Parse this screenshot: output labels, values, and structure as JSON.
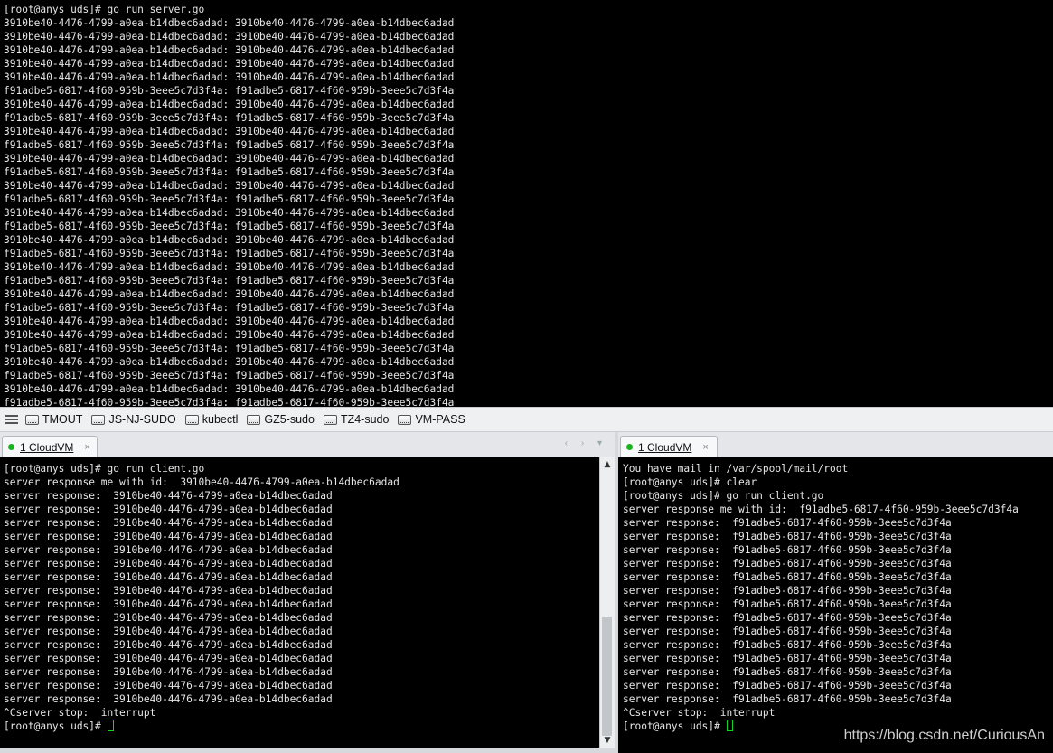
{
  "top_terminal": {
    "lines": [
      "[root@anys uds]# go run server.go",
      "3910be40-4476-4799-a0ea-b14dbec6adad: 3910be40-4476-4799-a0ea-b14dbec6adad",
      "3910be40-4476-4799-a0ea-b14dbec6adad: 3910be40-4476-4799-a0ea-b14dbec6adad",
      "3910be40-4476-4799-a0ea-b14dbec6adad: 3910be40-4476-4799-a0ea-b14dbec6adad",
      "3910be40-4476-4799-a0ea-b14dbec6adad: 3910be40-4476-4799-a0ea-b14dbec6adad",
      "3910be40-4476-4799-a0ea-b14dbec6adad: 3910be40-4476-4799-a0ea-b14dbec6adad",
      "f91adbe5-6817-4f60-959b-3eee5c7d3f4a: f91adbe5-6817-4f60-959b-3eee5c7d3f4a",
      "3910be40-4476-4799-a0ea-b14dbec6adad: 3910be40-4476-4799-a0ea-b14dbec6adad",
      "f91adbe5-6817-4f60-959b-3eee5c7d3f4a: f91adbe5-6817-4f60-959b-3eee5c7d3f4a",
      "3910be40-4476-4799-a0ea-b14dbec6adad: 3910be40-4476-4799-a0ea-b14dbec6adad",
      "f91adbe5-6817-4f60-959b-3eee5c7d3f4a: f91adbe5-6817-4f60-959b-3eee5c7d3f4a",
      "3910be40-4476-4799-a0ea-b14dbec6adad: 3910be40-4476-4799-a0ea-b14dbec6adad",
      "f91adbe5-6817-4f60-959b-3eee5c7d3f4a: f91adbe5-6817-4f60-959b-3eee5c7d3f4a",
      "3910be40-4476-4799-a0ea-b14dbec6adad: 3910be40-4476-4799-a0ea-b14dbec6adad",
      "f91adbe5-6817-4f60-959b-3eee5c7d3f4a: f91adbe5-6817-4f60-959b-3eee5c7d3f4a",
      "3910be40-4476-4799-a0ea-b14dbec6adad: 3910be40-4476-4799-a0ea-b14dbec6adad",
      "f91adbe5-6817-4f60-959b-3eee5c7d3f4a: f91adbe5-6817-4f60-959b-3eee5c7d3f4a",
      "3910be40-4476-4799-a0ea-b14dbec6adad: 3910be40-4476-4799-a0ea-b14dbec6adad",
      "f91adbe5-6817-4f60-959b-3eee5c7d3f4a: f91adbe5-6817-4f60-959b-3eee5c7d3f4a",
      "3910be40-4476-4799-a0ea-b14dbec6adad: 3910be40-4476-4799-a0ea-b14dbec6adad",
      "f91adbe5-6817-4f60-959b-3eee5c7d3f4a: f91adbe5-6817-4f60-959b-3eee5c7d3f4a",
      "3910be40-4476-4799-a0ea-b14dbec6adad: 3910be40-4476-4799-a0ea-b14dbec6adad",
      "f91adbe5-6817-4f60-959b-3eee5c7d3f4a: f91adbe5-6817-4f60-959b-3eee5c7d3f4a",
      "3910be40-4476-4799-a0ea-b14dbec6adad: 3910be40-4476-4799-a0ea-b14dbec6adad",
      "3910be40-4476-4799-a0ea-b14dbec6adad: 3910be40-4476-4799-a0ea-b14dbec6adad",
      "f91adbe5-6817-4f60-959b-3eee5c7d3f4a: f91adbe5-6817-4f60-959b-3eee5c7d3f4a",
      "3910be40-4476-4799-a0ea-b14dbec6adad: 3910be40-4476-4799-a0ea-b14dbec6adad",
      "f91adbe5-6817-4f60-959b-3eee5c7d3f4a: f91adbe5-6817-4f60-959b-3eee5c7d3f4a",
      "3910be40-4476-4799-a0ea-b14dbec6adad: 3910be40-4476-4799-a0ea-b14dbec6adad",
      "f91adbe5-6817-4f60-959b-3eee5c7d3f4a: f91adbe5-6817-4f60-959b-3eee5c7d3f4a"
    ]
  },
  "toolbar": {
    "menu_icon": "hamburger-menu-icon",
    "bookmarks": [
      "TMOUT",
      "JS-NJ-SUDO",
      "kubectl",
      "GZ5-sudo",
      "TZ4-sudo",
      "VM-PASS"
    ]
  },
  "left_tab": {
    "label": "1 CloudVM",
    "close": "×"
  },
  "right_tab": {
    "label": "1 CloudVM",
    "close": "×"
  },
  "nav_arrows": "‹ › ▾",
  "left_terminal": {
    "lines": [
      "[root@anys uds]# go run client.go",
      "server response me with id:  3910be40-4476-4799-a0ea-b14dbec6adad",
      "server response:  3910be40-4476-4799-a0ea-b14dbec6adad",
      "server response:  3910be40-4476-4799-a0ea-b14dbec6adad",
      "server response:  3910be40-4476-4799-a0ea-b14dbec6adad",
      "server response:  3910be40-4476-4799-a0ea-b14dbec6adad",
      "server response:  3910be40-4476-4799-a0ea-b14dbec6adad",
      "server response:  3910be40-4476-4799-a0ea-b14dbec6adad",
      "server response:  3910be40-4476-4799-a0ea-b14dbec6adad",
      "server response:  3910be40-4476-4799-a0ea-b14dbec6adad",
      "server response:  3910be40-4476-4799-a0ea-b14dbec6adad",
      "server response:  3910be40-4476-4799-a0ea-b14dbec6adad",
      "server response:  3910be40-4476-4799-a0ea-b14dbec6adad",
      "server response:  3910be40-4476-4799-a0ea-b14dbec6adad",
      "server response:  3910be40-4476-4799-a0ea-b14dbec6adad",
      "server response:  3910be40-4476-4799-a0ea-b14dbec6adad",
      "server response:  3910be40-4476-4799-a0ea-b14dbec6adad",
      "server response:  3910be40-4476-4799-a0ea-b14dbec6adad",
      "^Cserver stop:  interrupt"
    ],
    "prompt": "[root@anys uds]# "
  },
  "right_terminal": {
    "lines": [
      "You have mail in /var/spool/mail/root",
      "[root@anys uds]# clear",
      "[root@anys uds]# go run client.go",
      "server response me with id:  f91adbe5-6817-4f60-959b-3eee5c7d3f4a",
      "server response:  f91adbe5-6817-4f60-959b-3eee5c7d3f4a",
      "server response:  f91adbe5-6817-4f60-959b-3eee5c7d3f4a",
      "server response:  f91adbe5-6817-4f60-959b-3eee5c7d3f4a",
      "server response:  f91adbe5-6817-4f60-959b-3eee5c7d3f4a",
      "server response:  f91adbe5-6817-4f60-959b-3eee5c7d3f4a",
      "server response:  f91adbe5-6817-4f60-959b-3eee5c7d3f4a",
      "server response:  f91adbe5-6817-4f60-959b-3eee5c7d3f4a",
      "server response:  f91adbe5-6817-4f60-959b-3eee5c7d3f4a",
      "server response:  f91adbe5-6817-4f60-959b-3eee5c7d3f4a",
      "server response:  f91adbe5-6817-4f60-959b-3eee5c7d3f4a",
      "server response:  f91adbe5-6817-4f60-959b-3eee5c7d3f4a",
      "server response:  f91adbe5-6817-4f60-959b-3eee5c7d3f4a",
      "server response:  f91adbe5-6817-4f60-959b-3eee5c7d3f4a",
      "server response:  f91adbe5-6817-4f60-959b-3eee5c7d3f4a",
      "^Cserver stop:  interrupt"
    ],
    "prompt": "[root@anys uds]# "
  },
  "scrollbar": {
    "up": "▲",
    "down": "▼"
  },
  "watermark": "https://blog.csdn.net/CuriousAn",
  "colors": {
    "terminal_bg": "#000000",
    "terminal_fg": "#e6e6e6",
    "cursor": "#16d31f",
    "status_dot": "#16b41d",
    "toolbar_bg": "#eef0f2"
  }
}
